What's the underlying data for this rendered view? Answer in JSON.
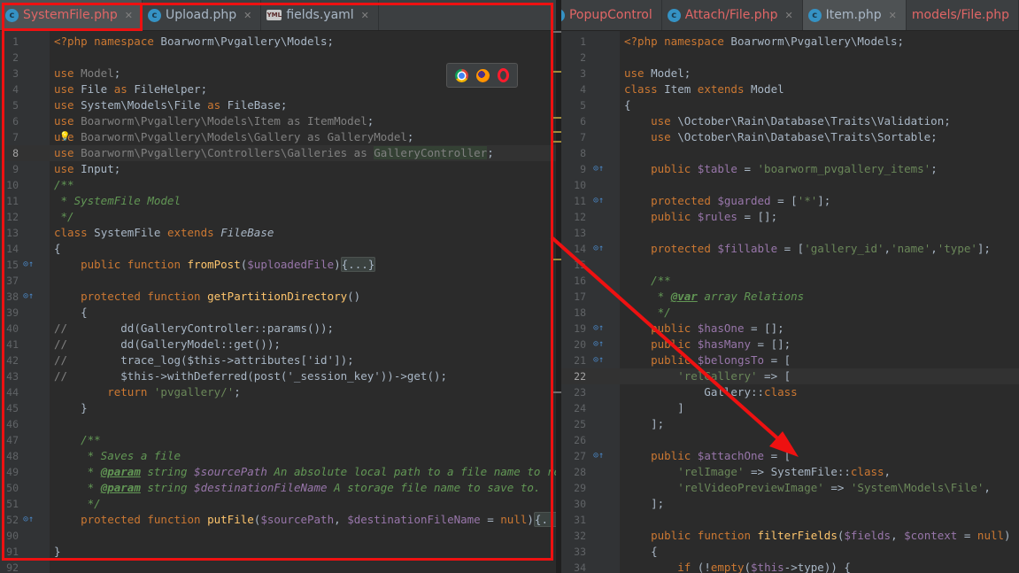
{
  "left_pane": {
    "tabs": [
      {
        "label": "SystemFile.php",
        "icon": "php-class-icon",
        "active": true,
        "error": true,
        "close": "✕"
      },
      {
        "label": "Upload.php",
        "icon": "php-class-icon",
        "active": false,
        "error": false,
        "close": "✕"
      },
      {
        "label": "fields.yaml",
        "icon": "yaml-file-icon",
        "active": false,
        "error": false,
        "close": "✕"
      }
    ],
    "lines": [
      {
        "n": "1",
        "html": "<span class=\"k\">&lt;?php namespace</span> Boarworm\\Pvgallery\\Models;"
      },
      {
        "n": "2",
        "html": ""
      },
      {
        "n": "3",
        "html": "<span class=\"k\">use</span> <span class=\"dim\">Model</span>;"
      },
      {
        "n": "4",
        "html": "<span class=\"k\">use</span> File <span class=\"k\">as</span> FileHelper;"
      },
      {
        "n": "5",
        "html": "<span class=\"k\">use</span> System\\Models\\File <span class=\"k\">as</span> FileBase;"
      },
      {
        "n": "6",
        "html": "<span class=\"k\">use</span> <span class=\"dim\">Boarworm\\Pvgallery\\Models\\Item</span> <span class=\"dim\">as</span> <span class=\"dim\">ItemModel</span>;"
      },
      {
        "n": "7",
        "html": "<span class=\"k\">use</span> <span class=\"dim\">Boarworm\\Pvgallery\\Models\\Gallery</span> <span class=\"dim\">as</span> <span class=\"dim\">GalleryModel</span>;",
        "bulb": true
      },
      {
        "n": "8",
        "html": "<span class=\"k\">use</span> <span class=\"dim\">Boarworm\\Pvgallery\\Controllers\\Galleries</span> <span class=\"dim\">as</span> <span class=\"hl dim\">GalleryController</span>;",
        "caret": true
      },
      {
        "n": "9",
        "html": "<span class=\"k\">use</span> Input;"
      },
      {
        "n": "10",
        "html": "<span class=\"c\">/**</span>"
      },
      {
        "n": "11",
        "html": "<span class=\"c\"> * SystemFile Model</span>"
      },
      {
        "n": "12",
        "html": "<span class=\"c\"> */</span>"
      },
      {
        "n": "13",
        "html": "<span class=\"k\">class</span> SystemFile <span class=\"k\">extends</span> <span class=\"i\">FileBase</span>"
      },
      {
        "n": "14",
        "html": "{"
      },
      {
        "n": "15",
        "html": "    <span class=\"k\">public function</span> <span class=\"f\">fromPost</span>(<span class=\"v\">$uploadedFile</span>)<span class=\"fold\">{...}</span>",
        "marker": "⊙↑"
      },
      {
        "n": "37",
        "html": ""
      },
      {
        "n": "38",
        "html": "    <span class=\"k\">protected function</span> <span class=\"f\">getPartitionDirectory</span>()",
        "marker": "⊙↑"
      },
      {
        "n": "39",
        "html": "    {"
      },
      {
        "n": "40",
        "html": "<span class=\"ln-c\">//</span>        dd(GalleryController::params());"
      },
      {
        "n": "41",
        "html": "<span class=\"ln-c\">//</span>        dd(GalleryModel::get());"
      },
      {
        "n": "42",
        "html": "<span class=\"ln-c\">//</span>        trace_log($this->attributes['id']);"
      },
      {
        "n": "43",
        "html": "<span class=\"ln-c\">//</span>        $this->withDeferred(post('_session_key'))->get();"
      },
      {
        "n": "44",
        "html": "        <span class=\"k\">return</span> <span class=\"s\">'pvgallery/'</span>;"
      },
      {
        "n": "45",
        "html": "    }"
      },
      {
        "n": "46",
        "html": ""
      },
      {
        "n": "47",
        "html": "    <span class=\"c\">/**</span>"
      },
      {
        "n": "48",
        "html": "<span class=\"c\">     * Saves a file</span>"
      },
      {
        "n": "49",
        "html": "<span class=\"c\">     * <span class=\"tag\">@param</span> string <span class=\"v\">$sourcePath</span> An absolute local path to a file name to read from</span>"
      },
      {
        "n": "50",
        "html": "<span class=\"c\">     * <span class=\"tag\">@param</span> string <span class=\"v\">$destinationFileName</span> A storage file name to save to.</span>"
      },
      {
        "n": "51",
        "html": "<span class=\"c\">     */</span>"
      },
      {
        "n": "52",
        "html": "    <span class=\"k\">protected function</span> <span class=\"f\">putFile</span>(<span class=\"v\">$sourcePath</span>, <span class=\"v\">$destinationFileName</span> = <span class=\"k\">null</span>)<span class=\"fold\">{...}</span>",
        "marker": "⊙↑"
      },
      {
        "n": "90",
        "html": ""
      },
      {
        "n": "91",
        "html": "}"
      },
      {
        "n": "92",
        "html": ""
      }
    ]
  },
  "right_pane": {
    "tabs": [
      {
        "label": "models/File.php",
        "icon": "",
        "active": false,
        "error": true,
        "close": ""
      },
      {
        "label": "Item.php",
        "icon": "php-class-icon",
        "active": true,
        "error": false,
        "close": "✕"
      },
      {
        "label": "Attach/File.php",
        "icon": "php-class-icon",
        "active": false,
        "error": true,
        "close": "✕"
      },
      {
        "label": "PopupControl",
        "icon": "php-class-icon",
        "active": false,
        "error": true,
        "close": ""
      }
    ],
    "lines": [
      {
        "n": "1",
        "html": "<span class=\"k\">&lt;?php namespace</span> Boarworm\\Pvgallery\\Models;"
      },
      {
        "n": "2",
        "html": ""
      },
      {
        "n": "3",
        "html": "<span class=\"k\">use</span> Model;"
      },
      {
        "n": "4",
        "html": "<span class=\"k\">class</span> Item <span class=\"k\">extends</span> Model"
      },
      {
        "n": "5",
        "html": "{"
      },
      {
        "n": "6",
        "html": "    <span class=\"k\">use</span> \\October\\Rain\\Database\\Traits\\Validation;"
      },
      {
        "n": "7",
        "html": "    <span class=\"k\">use</span> \\October\\Rain\\Database\\Traits\\Sortable;"
      },
      {
        "n": "8",
        "html": ""
      },
      {
        "n": "9",
        "html": "    <span class=\"k\">public</span> <span class=\"v\">$table</span> = <span class=\"s\">'boarworm_pvgallery_items'</span>;",
        "marker": "⊙↑"
      },
      {
        "n": "10",
        "html": ""
      },
      {
        "n": "11",
        "html": "    <span class=\"k\">protected</span> <span class=\"v\">$guarded</span> = [<span class=\"s\">'*'</span>];",
        "marker": "⊙↑"
      },
      {
        "n": "12",
        "html": "    <span class=\"k\">public</span> <span class=\"v\">$rules</span> = [];"
      },
      {
        "n": "13",
        "html": ""
      },
      {
        "n": "14",
        "html": "    <span class=\"k\">protected</span> <span class=\"v\">$fillable</span> = [<span class=\"s\">'gallery_id'</span>,<span class=\"s\">'name'</span>,<span class=\"s\">'type'</span>];",
        "marker": "⊙↑"
      },
      {
        "n": "15",
        "html": ""
      },
      {
        "n": "16",
        "html": "    <span class=\"c\">/**</span>"
      },
      {
        "n": "17",
        "html": "<span class=\"c\">     * <span class=\"tag\">@var</span> array Relations</span>"
      },
      {
        "n": "18",
        "html": "<span class=\"c\">     */</span>"
      },
      {
        "n": "19",
        "html": "    <span class=\"k\">public</span> <span class=\"v\">$hasOne</span> = [];",
        "marker": "⊙↑"
      },
      {
        "n": "20",
        "html": "    <span class=\"k\">public</span> <span class=\"v\">$hasMany</span> = [];",
        "marker": "⊙↑"
      },
      {
        "n": "21",
        "html": "    <span class=\"k\">public</span> <span class=\"v\">$belongsTo</span> = [",
        "marker": "⊙↑"
      },
      {
        "n": "22",
        "html": "        <span class=\"s\">'relGallery'</span> => [",
        "caret": true
      },
      {
        "n": "23",
        "html": "            Gallery::<span class=\"k\">class</span>"
      },
      {
        "n": "24",
        "html": "        ]"
      },
      {
        "n": "25",
        "html": "    ];"
      },
      {
        "n": "26",
        "html": ""
      },
      {
        "n": "27",
        "html": "    <span class=\"k\">public</span> <span class=\"v\">$attachOne</span> = [",
        "marker": "⊙↑"
      },
      {
        "n": "28",
        "html": "        <span class=\"s\">'relImage'</span> => SystemFile::<span class=\"k\">class</span>,"
      },
      {
        "n": "29",
        "html": "        <span class=\"s\">'relVideoPreviewImage'</span> => <span class=\"s\">'System\\Models\\File'</span>,"
      },
      {
        "n": "30",
        "html": "    ];"
      },
      {
        "n": "31",
        "html": ""
      },
      {
        "n": "32",
        "html": "    <span class=\"k\">public function</span> <span class=\"f\">filterFields</span>(<span class=\"v\">$fields</span>, <span class=\"v\">$context</span> = <span class=\"k\">null</span>)"
      },
      {
        "n": "33",
        "html": "    {"
      },
      {
        "n": "34",
        "html": "        <span class=\"k\">if</span> (!<span class=\"k\">empty</span>(<span class=\"v\">$this</span>->type)) {"
      }
    ]
  },
  "browser_icons": [
    "chrome-icon",
    "firefox-icon",
    "opera-icon"
  ],
  "colors": {
    "annotation": "#ee1111",
    "keyword": "#cc7832",
    "string": "#6a8759",
    "function": "#ffc66d",
    "comment": "#629755",
    "variable": "#9876aa"
  }
}
